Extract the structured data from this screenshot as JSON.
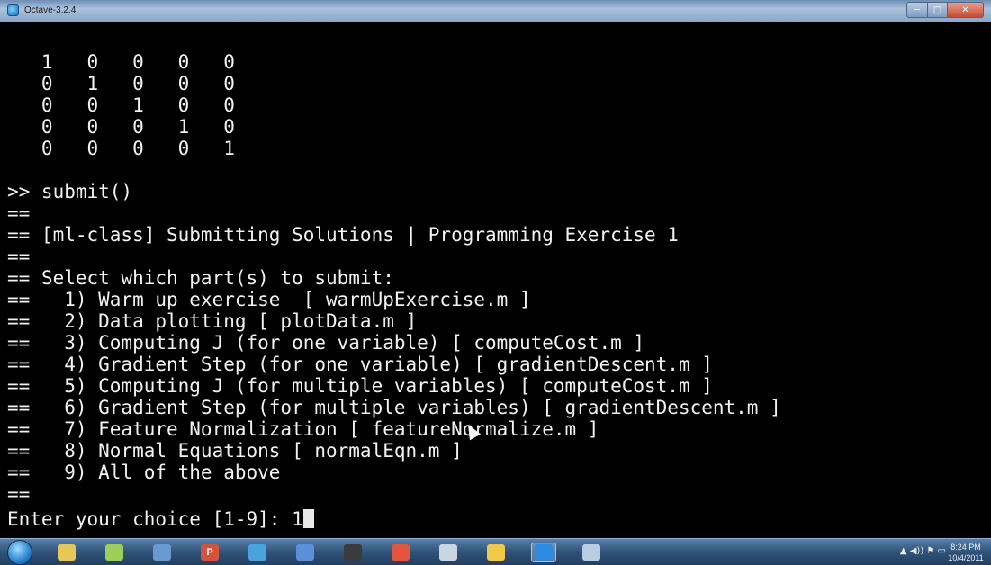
{
  "window": {
    "title": "Octave-3.2.4",
    "minimize_glyph": "─",
    "maximize_glyph": "□",
    "close_glyph": "✕"
  },
  "terminal": {
    "lines": [
      "   1   0   0   0   0",
      "   0   1   0   0   0",
      "   0   0   1   0   0",
      "   0   0   0   1   0",
      "   0   0   0   0   1",
      "",
      ">> submit()",
      "==",
      "== [ml-class] Submitting Solutions | Programming Exercise 1",
      "==",
      "== Select which part(s) to submit:",
      "==   1) Warm up exercise  [ warmUpExercise.m ]",
      "==   2) Data plotting [ plotData.m ]",
      "==   3) Computing J (for one variable) [ computeCost.m ]",
      "==   4) Gradient Step (for one variable) [ gradientDescent.m ]",
      "==   5) Computing J (for multiple variables) [ computeCost.m ]",
      "==   6) Gradient Step (for multiple variables) [ gradientDescent.m ]",
      "==   7) Feature Normalization [ featureNormalize.m ]",
      "==   8) Normal Equations [ normalEqn.m ]",
      "==   9) All of the above",
      "==",
      "Enter your choice [1-9]: 1"
    ]
  },
  "taskbar": {
    "apps": [
      {
        "icon": "explorer-folder-icon",
        "color": "#e8c75a",
        "glyph": ""
      },
      {
        "icon": "notepad-icon",
        "color": "#9bcf5a",
        "glyph": ""
      },
      {
        "icon": "paint-icon",
        "color": "#6a9ad0",
        "glyph": ""
      },
      {
        "icon": "powerpoint-icon",
        "color": "#d2553b",
        "glyph": "P"
      },
      {
        "icon": "network-icon",
        "color": "#4aa3df",
        "glyph": ""
      },
      {
        "icon": "remote-desktop-icon",
        "color": "#5b8fd9",
        "glyph": ""
      },
      {
        "icon": "media-device-icon",
        "color": "#3b3b3b",
        "glyph": ""
      },
      {
        "icon": "chrome-icon",
        "color": "#e2553f",
        "glyph": ""
      },
      {
        "icon": "webcam-icon",
        "color": "#c9d6e2",
        "glyph": ""
      },
      {
        "icon": "python-icon",
        "color": "#f0c84a",
        "glyph": ""
      },
      {
        "icon": "octave-icon",
        "color": "#2c8be0",
        "glyph": ""
      },
      {
        "icon": "window-icon",
        "color": "#b8cde2",
        "glyph": ""
      }
    ],
    "clock_time": "8:24 PM",
    "clock_date": "10/4/2011",
    "tray_glyphs": "▲ ◀)) ⚑ ▭"
  }
}
